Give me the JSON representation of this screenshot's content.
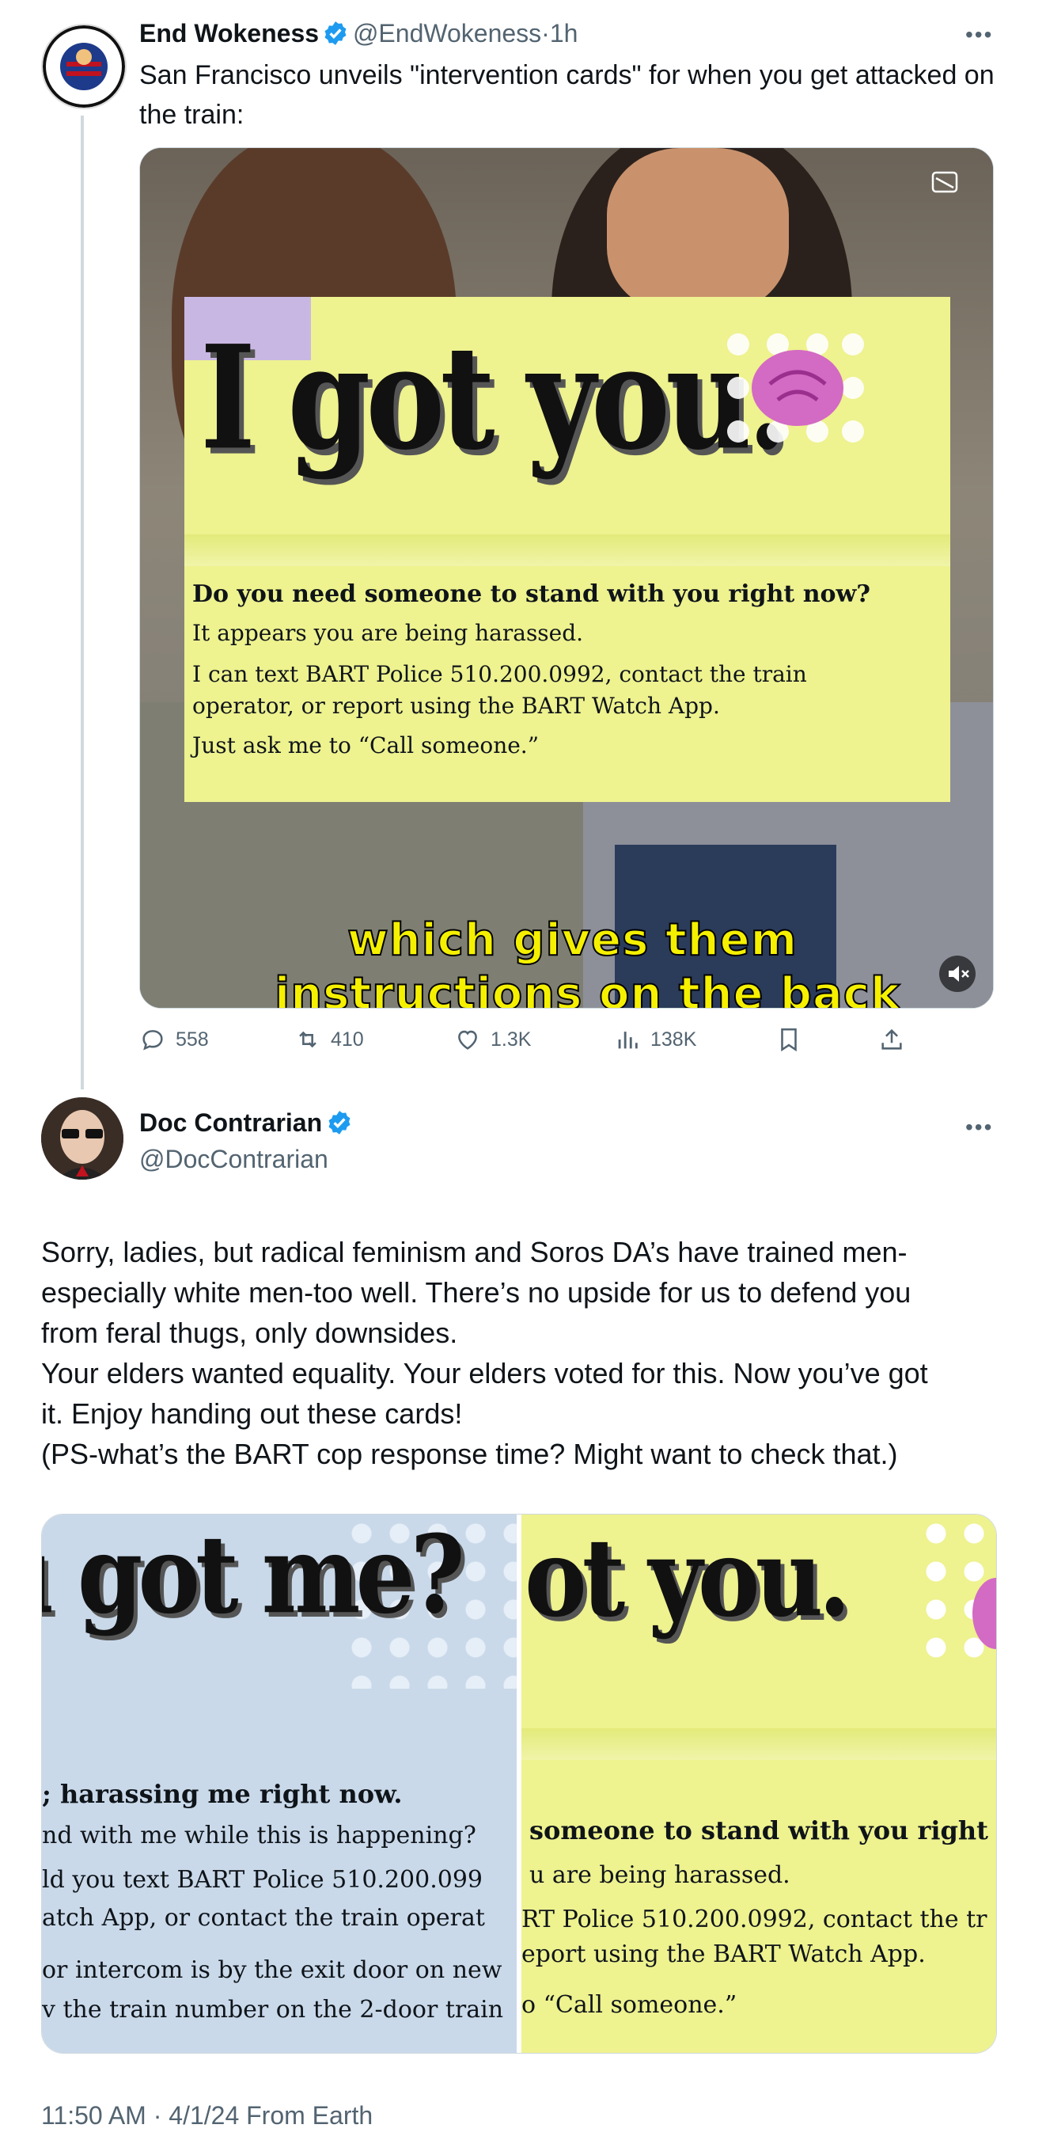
{
  "tweet1": {
    "author_name": "End Wokeness",
    "handle": "@EndWokeness",
    "separator": "·",
    "time": "1h",
    "text": "San Francisco unveils \"intervention cards\" for when you get attacked on the train:",
    "card": {
      "title": "I got you.",
      "headline": "Do you need someone to stand with you right now?",
      "line1": "It appears you are being harassed.",
      "line2": "I can text BART Police 510.200.0992, contact the train",
      "line3": "operator, or report using the BART Watch App.",
      "line4": "Just ask me to “Call someone.”"
    },
    "caption_line1": "which gives them",
    "caption_line2": "instructions on the back",
    "actions": {
      "replies": "558",
      "reposts": "410",
      "likes": "1.3K",
      "views": "138K"
    }
  },
  "tweet2": {
    "author_name": "Doc Contrarian",
    "handle": "@DocContrarian",
    "paragraphs": [
      "Sorry, ladies, but radical feminism and Soros DA’s have trained men-",
      "especially white men-too well. There’s no upside for us to defend you",
      "from feral thugs, only downsides.",
      "Your elders wanted equality. Your elders voted for this. Now you’ve got",
      "it. Enjoy handing out these cards!",
      "(PS-what’s the BART cop response time? Might want to check that.)"
    ],
    "left_card": {
      "title": "u got me?",
      "l1": "; harassing me right now.",
      "l2": "nd with me while this is happening?",
      "l3": "ld you text BART Police 510.200.099",
      "l4": "atch App, or contact the train operat",
      "l5": "or intercom is by the exit door on new",
      "l6": "v the train number on the 2-door train"
    },
    "right_card": {
      "title": "ot you.",
      "l1": "someone to stand with you right r",
      "l2": "u are being harassed.",
      "l3": "RT Police 510.200.0992, contact the tr",
      "l4": "eport using the BART Watch App.",
      "l5": "o “Call someone.”"
    },
    "timestamp": "11:50 AM · 4/1/24 From Earth"
  },
  "colors": {
    "verified": "#1d9bf0",
    "muted": "#536471",
    "card_yellow": "#eef28f",
    "card_blue": "#c9d9ea"
  }
}
